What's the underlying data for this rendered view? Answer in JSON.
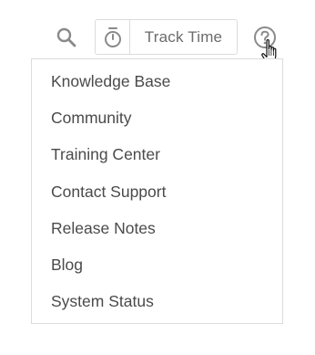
{
  "header": {
    "search_icon": "search-icon",
    "track_time": {
      "icon": "stopwatch-icon",
      "label": "Track Time"
    },
    "help_icon": "help-circle-icon"
  },
  "help_menu": {
    "items": [
      {
        "label": "Knowledge Base"
      },
      {
        "label": "Community"
      },
      {
        "label": "Training Center"
      },
      {
        "label": "Contact Support"
      },
      {
        "label": "Release Notes"
      },
      {
        "label": "Blog"
      },
      {
        "label": "System Status"
      }
    ]
  },
  "colors": {
    "icon_gray": "#8a8a8a",
    "border": "#dcdcdc",
    "text": "#4a4a4a"
  }
}
